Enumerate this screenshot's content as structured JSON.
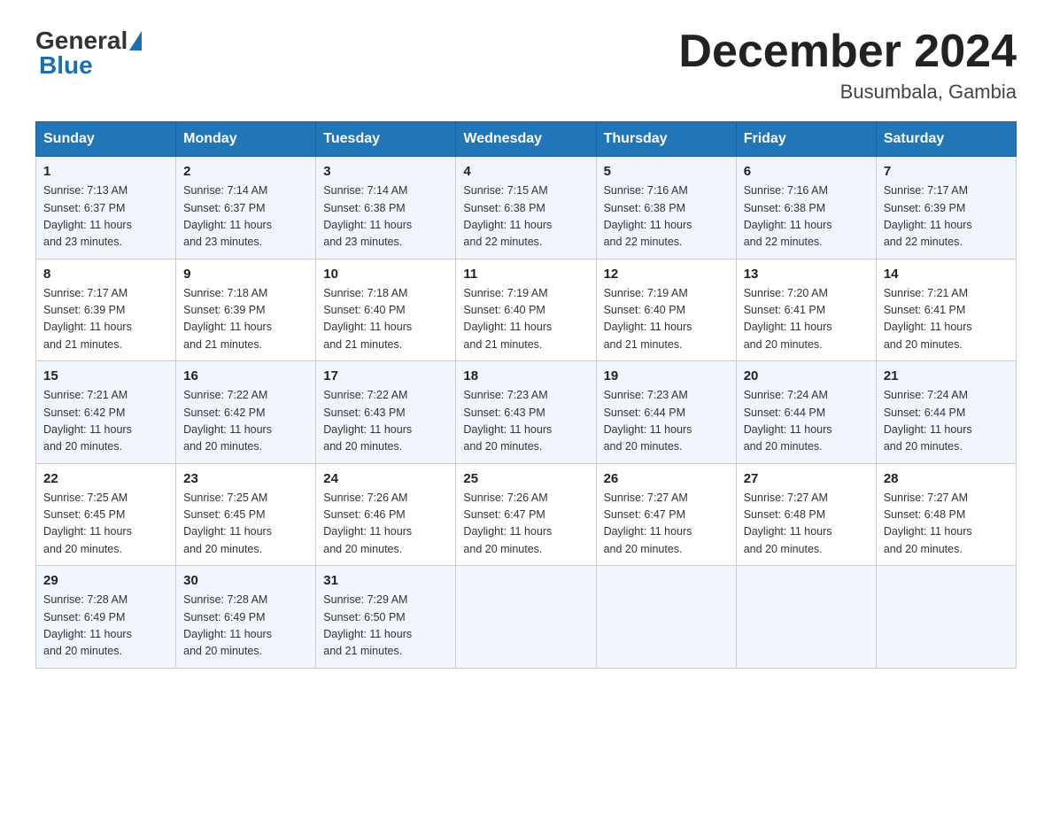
{
  "logo": {
    "general": "General",
    "blue": "Blue"
  },
  "header": {
    "title": "December 2024",
    "location": "Busumbala, Gambia"
  },
  "weekdays": [
    "Sunday",
    "Monday",
    "Tuesday",
    "Wednesday",
    "Thursday",
    "Friday",
    "Saturday"
  ],
  "weeks": [
    [
      {
        "day": "1",
        "sunrise": "7:13 AM",
        "sunset": "6:37 PM",
        "daylight": "11 hours and 23 minutes."
      },
      {
        "day": "2",
        "sunrise": "7:14 AM",
        "sunset": "6:37 PM",
        "daylight": "11 hours and 23 minutes."
      },
      {
        "day": "3",
        "sunrise": "7:14 AM",
        "sunset": "6:38 PM",
        "daylight": "11 hours and 23 minutes."
      },
      {
        "day": "4",
        "sunrise": "7:15 AM",
        "sunset": "6:38 PM",
        "daylight": "11 hours and 22 minutes."
      },
      {
        "day": "5",
        "sunrise": "7:16 AM",
        "sunset": "6:38 PM",
        "daylight": "11 hours and 22 minutes."
      },
      {
        "day": "6",
        "sunrise": "7:16 AM",
        "sunset": "6:38 PM",
        "daylight": "11 hours and 22 minutes."
      },
      {
        "day": "7",
        "sunrise": "7:17 AM",
        "sunset": "6:39 PM",
        "daylight": "11 hours and 22 minutes."
      }
    ],
    [
      {
        "day": "8",
        "sunrise": "7:17 AM",
        "sunset": "6:39 PM",
        "daylight": "11 hours and 21 minutes."
      },
      {
        "day": "9",
        "sunrise": "7:18 AM",
        "sunset": "6:39 PM",
        "daylight": "11 hours and 21 minutes."
      },
      {
        "day": "10",
        "sunrise": "7:18 AM",
        "sunset": "6:40 PM",
        "daylight": "11 hours and 21 minutes."
      },
      {
        "day": "11",
        "sunrise": "7:19 AM",
        "sunset": "6:40 PM",
        "daylight": "11 hours and 21 minutes."
      },
      {
        "day": "12",
        "sunrise": "7:19 AM",
        "sunset": "6:40 PM",
        "daylight": "11 hours and 21 minutes."
      },
      {
        "day": "13",
        "sunrise": "7:20 AM",
        "sunset": "6:41 PM",
        "daylight": "11 hours and 20 minutes."
      },
      {
        "day": "14",
        "sunrise": "7:21 AM",
        "sunset": "6:41 PM",
        "daylight": "11 hours and 20 minutes."
      }
    ],
    [
      {
        "day": "15",
        "sunrise": "7:21 AM",
        "sunset": "6:42 PM",
        "daylight": "11 hours and 20 minutes."
      },
      {
        "day": "16",
        "sunrise": "7:22 AM",
        "sunset": "6:42 PM",
        "daylight": "11 hours and 20 minutes."
      },
      {
        "day": "17",
        "sunrise": "7:22 AM",
        "sunset": "6:43 PM",
        "daylight": "11 hours and 20 minutes."
      },
      {
        "day": "18",
        "sunrise": "7:23 AM",
        "sunset": "6:43 PM",
        "daylight": "11 hours and 20 minutes."
      },
      {
        "day": "19",
        "sunrise": "7:23 AM",
        "sunset": "6:44 PM",
        "daylight": "11 hours and 20 minutes."
      },
      {
        "day": "20",
        "sunrise": "7:24 AM",
        "sunset": "6:44 PM",
        "daylight": "11 hours and 20 minutes."
      },
      {
        "day": "21",
        "sunrise": "7:24 AM",
        "sunset": "6:44 PM",
        "daylight": "11 hours and 20 minutes."
      }
    ],
    [
      {
        "day": "22",
        "sunrise": "7:25 AM",
        "sunset": "6:45 PM",
        "daylight": "11 hours and 20 minutes."
      },
      {
        "day": "23",
        "sunrise": "7:25 AM",
        "sunset": "6:45 PM",
        "daylight": "11 hours and 20 minutes."
      },
      {
        "day": "24",
        "sunrise": "7:26 AM",
        "sunset": "6:46 PM",
        "daylight": "11 hours and 20 minutes."
      },
      {
        "day": "25",
        "sunrise": "7:26 AM",
        "sunset": "6:47 PM",
        "daylight": "11 hours and 20 minutes."
      },
      {
        "day": "26",
        "sunrise": "7:27 AM",
        "sunset": "6:47 PM",
        "daylight": "11 hours and 20 minutes."
      },
      {
        "day": "27",
        "sunrise": "7:27 AM",
        "sunset": "6:48 PM",
        "daylight": "11 hours and 20 minutes."
      },
      {
        "day": "28",
        "sunrise": "7:27 AM",
        "sunset": "6:48 PM",
        "daylight": "11 hours and 20 minutes."
      }
    ],
    [
      {
        "day": "29",
        "sunrise": "7:28 AM",
        "sunset": "6:49 PM",
        "daylight": "11 hours and 20 minutes."
      },
      {
        "day": "30",
        "sunrise": "7:28 AM",
        "sunset": "6:49 PM",
        "daylight": "11 hours and 20 minutes."
      },
      {
        "day": "31",
        "sunrise": "7:29 AM",
        "sunset": "6:50 PM",
        "daylight": "11 hours and 21 minutes."
      },
      null,
      null,
      null,
      null
    ]
  ],
  "labels": {
    "sunrise": "Sunrise:",
    "sunset": "Sunset:",
    "daylight": "Daylight:"
  }
}
